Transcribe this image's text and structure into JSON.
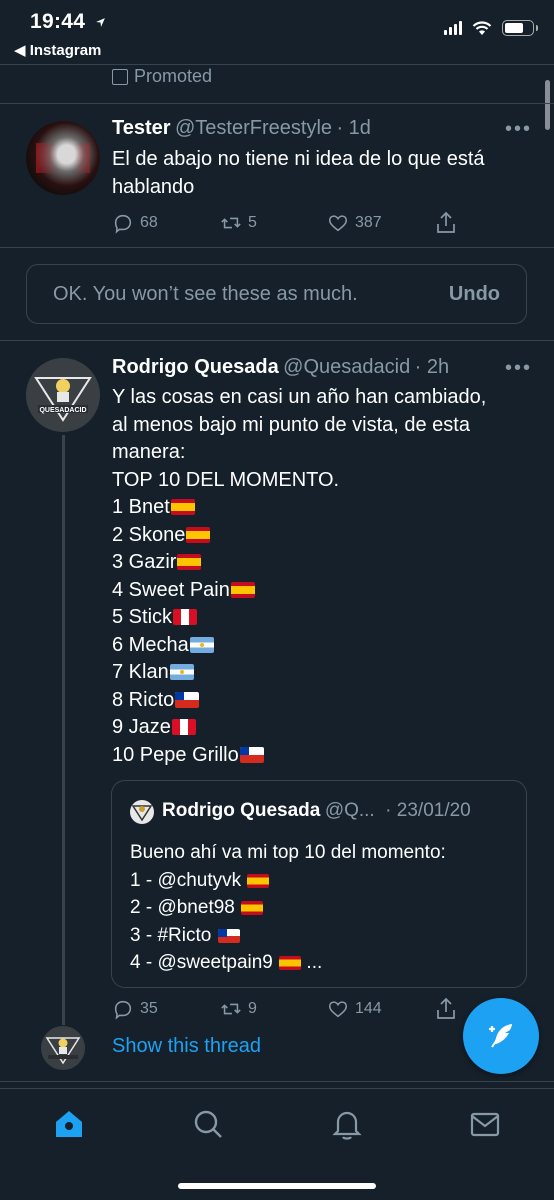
{
  "status_bar": {
    "time": "19:44",
    "back_app": "◀ Instagram"
  },
  "promoted_label": "Promoted",
  "tweet1": {
    "name": "Tester",
    "handle": "@TesterFreestyle",
    "time": "· 1d",
    "text_line1": "El de abajo no tiene ni idea de lo que está",
    "text_line2": "hablando",
    "replies": "68",
    "retweets": "5",
    "likes": "387"
  },
  "undo_bar": {
    "message": "OK. You won’t see these as much.",
    "button": "Undo"
  },
  "tweet2": {
    "name": "Rodrigo Quesada",
    "handle": "@Quesadacid",
    "time": "· 2h",
    "avatar_text": "QUESADACID",
    "lines": [
      "Y las cosas en casi un año han cambiado,",
      "al menos bajo mi punto de vista, de esta",
      "manera:",
      "TOP 10 DEL MOMENTO."
    ],
    "ranking": [
      {
        "text": "1 Bnet",
        "flag": "es"
      },
      {
        "text": "2 Skone",
        "flag": "es"
      },
      {
        "text": "3 Gazir",
        "flag": "es"
      },
      {
        "text": "4 Sweet Pain",
        "flag": "es"
      },
      {
        "text": "5 Stick",
        "flag": "pe"
      },
      {
        "text": "6 Mecha",
        "flag": "ar"
      },
      {
        "text": "7 Klan",
        "flag": "ar"
      },
      {
        "text": "8 Ricto",
        "flag": "cl"
      },
      {
        "text": "9 Jaze",
        "flag": "pe"
      },
      {
        "text": "10 Pepe Grillo",
        "flag": "cl"
      }
    ],
    "quote": {
      "name": "Rodrigo Quesada",
      "handle": "@Q...",
      "time": "· 23/01/20",
      "lines": [
        {
          "text": "Bueno ahí va mi top 10 del momento:",
          "flag": ""
        },
        {
          "text": "1 - @chutyvk ",
          "flag": "es"
        },
        {
          "text": "2 - @bnet98 ",
          "flag": "es"
        },
        {
          "text": "3 - #Ricto ",
          "flag": "cl"
        },
        {
          "text": "4 - @sweetpain9 ",
          "flag": "es",
          "suffix": " ..."
        }
      ]
    },
    "replies": "35",
    "retweets": "9",
    "likes": "144"
  },
  "show_thread": "Show this thread",
  "colors": {
    "background": "#15202b",
    "accent": "#1da1f2",
    "secondary_text": "#8899a6",
    "divider": "#38444d"
  }
}
